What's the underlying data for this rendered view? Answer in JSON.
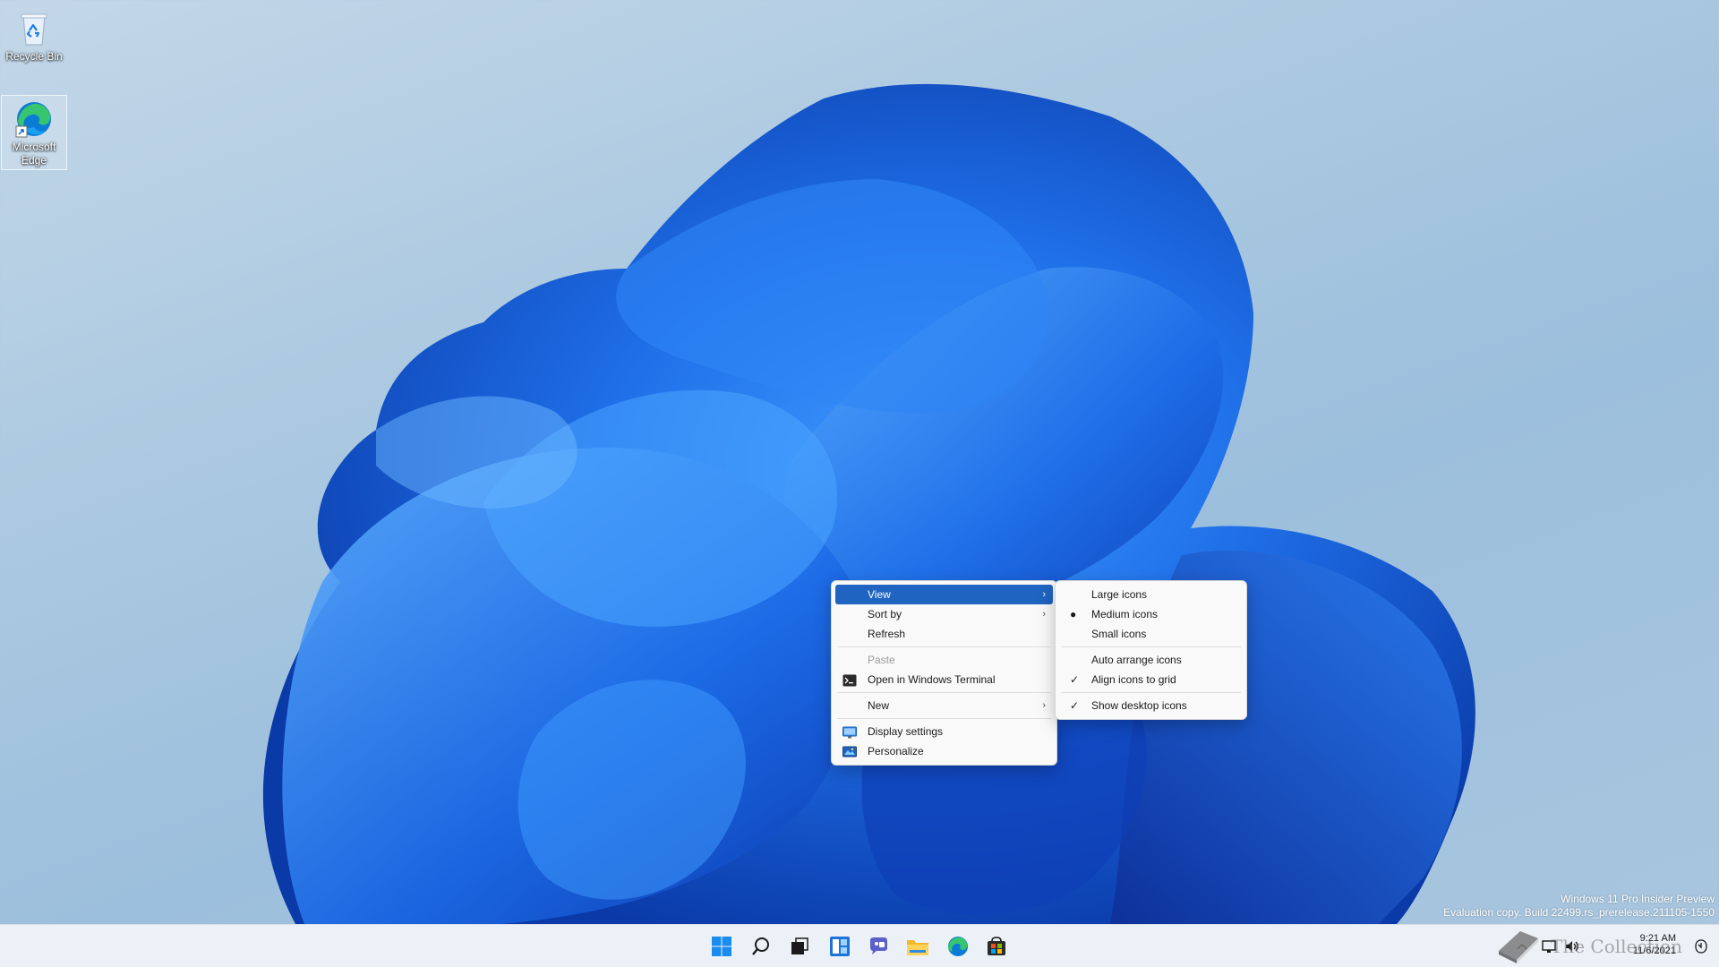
{
  "desktop": {
    "icons": [
      {
        "label": "Recycle Bin",
        "icon": "recycle-bin-icon"
      },
      {
        "label": "Microsoft Edge",
        "icon": "edge-icon"
      }
    ]
  },
  "context_menu": {
    "items": {
      "view": {
        "label": "View",
        "arrow": "›"
      },
      "sort_by": {
        "label": "Sort by",
        "arrow": "›"
      },
      "refresh": {
        "label": "Refresh"
      },
      "paste": {
        "label": "Paste"
      },
      "open_terminal": {
        "label": "Open in Windows Terminal",
        "icon": "terminal-icon"
      },
      "new": {
        "label": "New",
        "arrow": "›"
      },
      "display_settings": {
        "label": "Display settings",
        "icon": "display-settings-icon"
      },
      "personalize": {
        "label": "Personalize",
        "icon": "personalize-icon"
      }
    }
  },
  "view_submenu": {
    "large_icons": {
      "label": "Large icons"
    },
    "medium_icons": {
      "label": "Medium icons",
      "mark": "●"
    },
    "small_icons": {
      "label": "Small icons"
    },
    "auto_arrange": {
      "label": "Auto arrange icons"
    },
    "align_grid": {
      "label": "Align icons to grid",
      "mark": "✓"
    },
    "show_desktop_icons": {
      "label": "Show desktop icons",
      "mark": "✓"
    }
  },
  "watermark": {
    "line1": "Windows 11 Pro Insider Preview",
    "line2": "Evaluation copy. Build 22499.rs_prerelease.211105-1550"
  },
  "taskbar": {
    "apps": [
      "start-icon",
      "search-icon",
      "task-view-icon",
      "widgets-icon",
      "chat-icon",
      "file-explorer-icon",
      "edge-icon",
      "store-icon"
    ],
    "tray": [
      "chevron-up-icon",
      "network-icon",
      "volume-icon"
    ],
    "time": "9:21 AM",
    "date": "11/6/2021"
  },
  "brand_overlay": "The Collection Book",
  "colors": {
    "menu_highlight": "#1f64c0",
    "wallpaper_blue": "#1565e0",
    "taskbar_bg": "#eef2f8"
  }
}
